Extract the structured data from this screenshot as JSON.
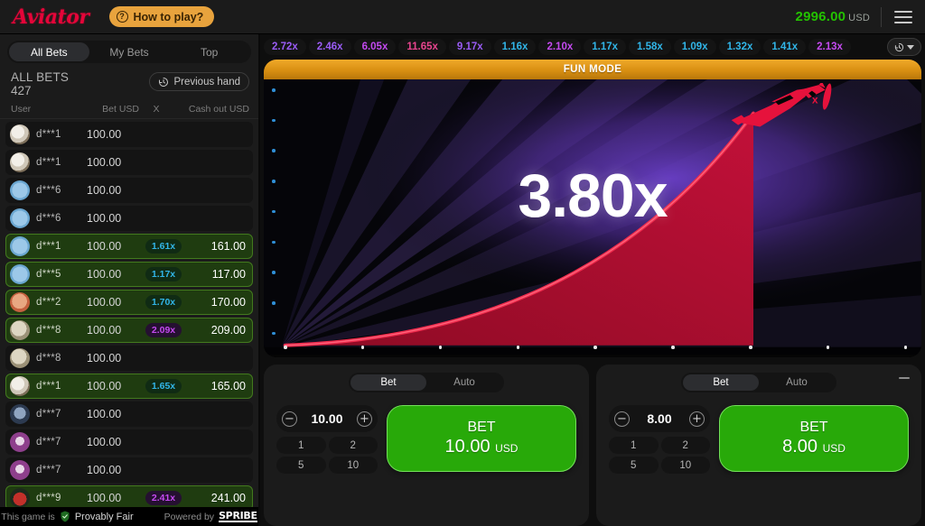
{
  "topbar": {
    "logo": "Aviator",
    "how_to_play": "How to play?",
    "question_icon": "question-circle-icon",
    "balance": "2996.00",
    "currency": "USD",
    "menu_icon": "hamburger-menu-icon"
  },
  "sidebar": {
    "tabs": [
      {
        "label": "All Bets",
        "active": true
      },
      {
        "label": "My Bets",
        "active": false
      },
      {
        "label": "Top",
        "active": false
      }
    ],
    "all_bets_label": "ALL BETS",
    "all_bets_count": "427",
    "previous_hand": "Previous hand",
    "previous_hand_icon": "history-clock-icon",
    "columns": {
      "user": "User",
      "bet": "Bet USD",
      "x": "X",
      "cash_out": "Cash out USD"
    },
    "rows": [
      {
        "user": "d***1",
        "bet": "100.00",
        "x": "",
        "cash": "",
        "win": false,
        "avatar": "eagle-avatar"
      },
      {
        "user": "d***1",
        "bet": "100.00",
        "x": "",
        "cash": "",
        "win": false,
        "avatar": "eagle-avatar"
      },
      {
        "user": "d***6",
        "bet": "100.00",
        "x": "",
        "cash": "",
        "win": false,
        "avatar": "plane-avatar"
      },
      {
        "user": "d***6",
        "bet": "100.00",
        "x": "",
        "cash": "",
        "win": false,
        "avatar": "plane-avatar"
      },
      {
        "user": "d***1",
        "bet": "100.00",
        "x": "1.61x",
        "cash": "161.00",
        "win": true,
        "avatar": "plane-avatar",
        "xcolor": "blue"
      },
      {
        "user": "d***5",
        "bet": "100.00",
        "x": "1.17x",
        "cash": "117.00",
        "win": true,
        "avatar": "plane-avatar",
        "xcolor": "blue"
      },
      {
        "user": "d***2",
        "bet": "100.00",
        "x": "1.70x",
        "cash": "170.00",
        "win": true,
        "avatar": "sunglasses-avatar",
        "xcolor": "blue"
      },
      {
        "user": "d***8",
        "bet": "100.00",
        "x": "2.09x",
        "cash": "209.00",
        "win": true,
        "avatar": "sheep-avatar",
        "xcolor": "purple"
      },
      {
        "user": "d***8",
        "bet": "100.00",
        "x": "",
        "cash": "",
        "win": false,
        "avatar": "sheep-avatar"
      },
      {
        "user": "d***1",
        "bet": "100.00",
        "x": "1.65x",
        "cash": "165.00",
        "win": true,
        "avatar": "eagle-avatar",
        "xcolor": "blue"
      },
      {
        "user": "d***7",
        "bet": "100.00",
        "x": "",
        "cash": "",
        "win": false,
        "avatar": "skull-avatar"
      },
      {
        "user": "d***7",
        "bet": "100.00",
        "x": "",
        "cash": "",
        "win": false,
        "avatar": "purple-hair-avatar"
      },
      {
        "user": "d***7",
        "bet": "100.00",
        "x": "",
        "cash": "",
        "win": false,
        "avatar": "purple-hair-avatar"
      },
      {
        "user": "d***9",
        "bet": "100.00",
        "x": "2.41x",
        "cash": "241.00",
        "win": true,
        "avatar": "car-avatar",
        "xcolor": "purple"
      }
    ],
    "footer": {
      "this_game_is": "This game is",
      "provably_fair": "Provably Fair",
      "shield_icon": "shield-check-icon",
      "powered_by": "Powered by",
      "brand": "SPRIBE"
    }
  },
  "history": {
    "items": [
      {
        "value": "2.72x",
        "color": "#9a5cf5"
      },
      {
        "value": "2.46x",
        "color": "#9a5cf5"
      },
      {
        "value": "6.05x",
        "color": "#c44af0"
      },
      {
        "value": "11.65x",
        "color": "#e8458f"
      },
      {
        "value": "9.17x",
        "color": "#9a5cf5"
      },
      {
        "value": "1.16x",
        "color": "#31b5e8"
      },
      {
        "value": "2.10x",
        "color": "#c44af0"
      },
      {
        "value": "1.17x",
        "color": "#31b5e8"
      },
      {
        "value": "1.58x",
        "color": "#31b5e8"
      },
      {
        "value": "1.09x",
        "color": "#31b5e8"
      },
      {
        "value": "1.32x",
        "color": "#31b5e8"
      },
      {
        "value": "1.41x",
        "color": "#31b5e8"
      },
      {
        "value": "2.13x",
        "color": "#c44af0"
      }
    ],
    "toggle_icon": "history-clock-icon",
    "caret_icon": "chevron-down-icon"
  },
  "game": {
    "mode_banner": "FUN MODE",
    "multiplier": "3.80x",
    "plane_icon": "red-plane-icon",
    "curve_color": "#ef2a4c",
    "area_color": "#9d0d29"
  },
  "panels": [
    {
      "tabs": [
        {
          "label": "Bet",
          "active": true
        },
        {
          "label": "Auto",
          "active": false
        }
      ],
      "stake": "10.00",
      "minus_icon": "minus-circle-icon",
      "plus_icon": "plus-circle-icon",
      "quick_amounts": [
        "1",
        "2",
        "5",
        "10"
      ],
      "bet_label": "BET",
      "bet_amount": "10.00",
      "bet_currency": "USD",
      "collapse": false
    },
    {
      "tabs": [
        {
          "label": "Bet",
          "active": true
        },
        {
          "label": "Auto",
          "active": false
        }
      ],
      "stake": "8.00",
      "minus_icon": "minus-circle-icon",
      "plus_icon": "plus-circle-icon",
      "quick_amounts": [
        "1",
        "2",
        "5",
        "10"
      ],
      "bet_label": "BET",
      "bet_amount": "8.00",
      "bet_currency": "USD",
      "collapse": true,
      "collapse_icon": "minus-icon"
    }
  ]
}
